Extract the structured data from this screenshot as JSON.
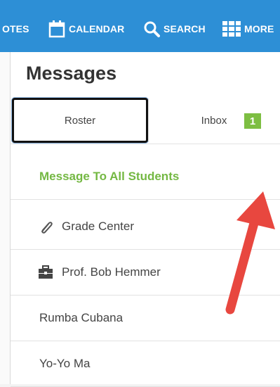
{
  "nav": {
    "notes_label": "OTES",
    "calendar_label": "CALENDAR",
    "search_label": "SEARCH",
    "more_label": "MORE"
  },
  "page_title": "Messages",
  "tabs": [
    {
      "label": "Roster",
      "active": true
    },
    {
      "label": "Inbox",
      "active": false
    }
  ],
  "rows": [
    {
      "label": "Message To All Students",
      "badge": "1",
      "highlight": true
    },
    {
      "label": "Grade Center",
      "icon": "paperclip-icon"
    },
    {
      "label": "Prof. Bob Hemmer",
      "icon": "briefcase-icon"
    },
    {
      "label": "Rumba Cubana"
    },
    {
      "label": "Yo-Yo Ma"
    }
  ],
  "colors": {
    "topbar": "#2d8fd6",
    "highlight_text": "#74b843",
    "badge": "#7dbe42",
    "annotation_arrow": "#e8473f"
  }
}
